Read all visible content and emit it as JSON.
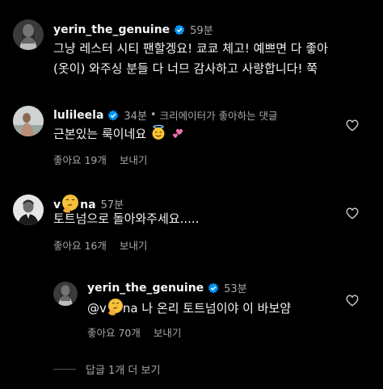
{
  "comments": [
    {
      "username": "yerin_the_genuine",
      "time": "59분",
      "lines": [
        "그냥 레스터 시티 팬할겡요! 쿄쿄 체고! 예쁘면 다 좋아",
        "(옷이) 와주싱 분들 다 너므 감사하고 사랑합니다! 쭉"
      ]
    },
    {
      "username": "lulileela",
      "time": "34분",
      "creator_liked": "크리에이터가 좋아하는 댓글",
      "text": "근본있는 룩이네요",
      "likes_label": "좋아요 19개",
      "reply_label": "보내기"
    },
    {
      "username_prefix": "v",
      "username_suffix": "na",
      "time": "57분",
      "text": "토트넘으로 돌아와주세요.....",
      "likes_label": "좋아요 16개",
      "reply_label": "보내기"
    },
    {
      "username": "yerin_the_genuine",
      "time": "53분",
      "mention_prefix": "@v",
      "mention_suffix": "na",
      "text": "나 온리 토트넘이야 이 바보얌",
      "likes_label": "좋아요 70개",
      "reply_label": "보내기"
    }
  ],
  "more_replies_label": "답글 1개 더 보기",
  "colors": {
    "background": "#000000",
    "text": "#f5f5f5",
    "secondary": "#a8a8a8",
    "verified": "#0095f6"
  }
}
